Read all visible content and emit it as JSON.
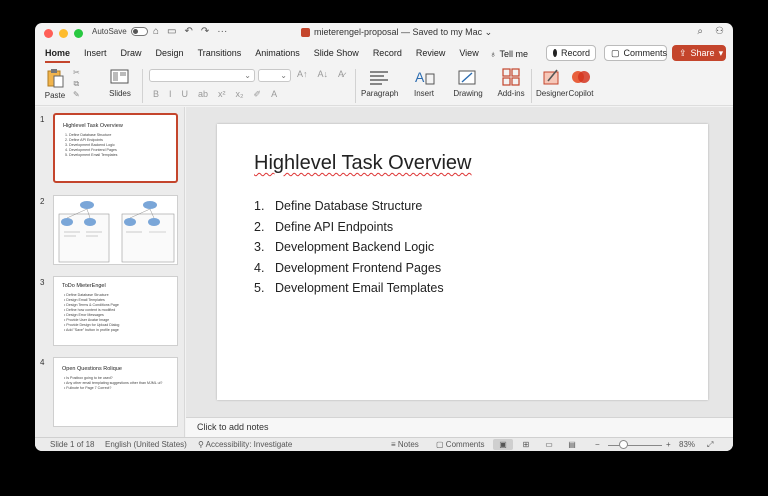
{
  "window": {
    "autosave_label": "AutoSave",
    "doc_title": "mieterengel-proposal — Saved to my Mac ⌄"
  },
  "ribbon": {
    "tabs": [
      "Home",
      "Insert",
      "Draw",
      "Design",
      "Transitions",
      "Animations",
      "Slide Show",
      "Record",
      "Review",
      "View"
    ],
    "tell_me": "Tell me",
    "record_button": "Record",
    "comments_button": "Comments",
    "share_button": "Share",
    "paste_label": "Paste",
    "slides_label": "Slides",
    "paragraph_label": "Paragraph",
    "insert_label": "Insert",
    "drawing_label": "Drawing",
    "addins_label": "Add-ins",
    "designer_label": "Designer",
    "copilot_label": "Copilot",
    "format_buttons": [
      "B",
      "I",
      "U",
      "ab",
      "x²",
      "x₂"
    ]
  },
  "thumbnails": [
    {
      "number": "1",
      "title": "Highlevel Task Overview",
      "lines": [
        "1. Define Database Structure",
        "2. Define API Endpoints",
        "3. Development Backend Logic",
        "4. Development Frontend Pages",
        "5. Development Email Templates"
      ]
    },
    {
      "number": "2"
    },
    {
      "number": "3",
      "title": "ToDo MieterEngel",
      "lines": [
        "• Define Database Structure",
        "• Design Email Templates",
        "• Design Terms & Conditions Page",
        "• Define how content is modified",
        "• Design Error Messages",
        "• Provide User Avatar Image",
        "• Provide Design for Upload Dialog",
        "• Add \"Save\" button in profile page"
      ]
    },
    {
      "number": "4",
      "title": "Open Questions Rolique",
      "lines": [
        "• Is Postbox going to be used?",
        "• Any other email templating suggestions other than MJML ui?",
        "• Fullnote for Page 7 Correct?"
      ]
    }
  ],
  "slide": {
    "title": "Highlevel Task Overview",
    "items": [
      {
        "n": "1.",
        "text": "Define Database Structure"
      },
      {
        "n": "2.",
        "text": "Define API Endpoints"
      },
      {
        "n": "3.",
        "text": "Development Backend Logic"
      },
      {
        "n": "4.",
        "text": "Development Frontend Pages"
      },
      {
        "n": "5.",
        "text": "Development Email Templates"
      }
    ]
  },
  "notes_placeholder": "Click to add notes",
  "status": {
    "slide_count": "Slide 1 of 18",
    "language": "English (United States)",
    "accessibility": "Accessibility: Investigate",
    "notes": "Notes",
    "comments": "Comments",
    "zoom": "83%",
    "zoom_fraction": 0.3
  },
  "colors": {
    "accent": "#c4452c"
  }
}
